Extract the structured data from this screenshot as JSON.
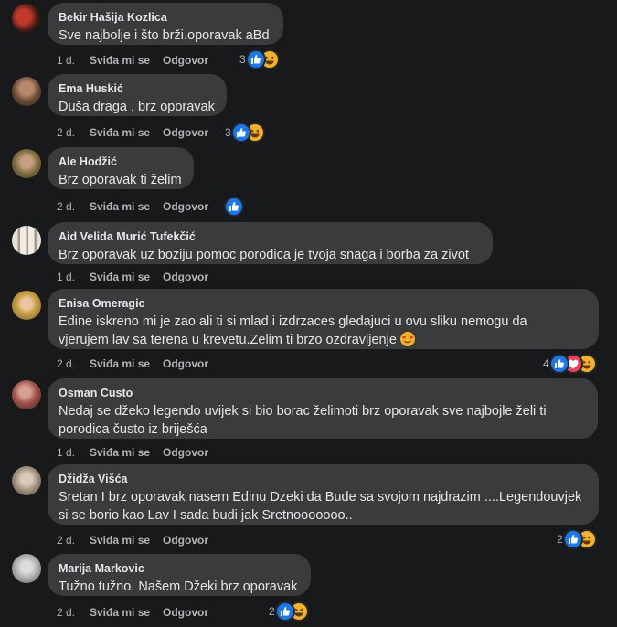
{
  "comments": [
    {
      "author": "Bekir Hašija Kozlica",
      "text": "Sve najbolje i što brži.oporavak aBd",
      "time": "1 d.",
      "like": "Sviđa mi se",
      "reply": "Odgovor",
      "count": "3"
    },
    {
      "author": "Ema Huskić",
      "text": "Duša draga , brz oporavak",
      "time": "2 d.",
      "like": "Sviđa mi se",
      "reply": "Odgovor",
      "count": "3"
    },
    {
      "author": "Ale Hodžić",
      "text": "Brz oporavak ti želim",
      "time": "2 d.",
      "like": "Sviđa mi se",
      "reply": "Odgovor",
      "count": ""
    },
    {
      "author": "Aid Velida Murić Tufekčić",
      "text": "Brz oporavak uz boziju pomoc porodica je tvoja snaga i borba za zivot",
      "time": "1 d.",
      "like": "Sviđa mi se",
      "reply": "Odgovor",
      "count": ""
    },
    {
      "author": "Enisa Omeragic",
      "text": "Edine iskreno mi je zao ali ti si mlad i izdrzaces gledajuci u ovu sliku nemogu da\nvjerujem lav sa terena u krevetu.Zelim ti brzo ozdravljenje",
      "time": "2 d.",
      "like": "Sviđa mi se",
      "reply": "Odgovor",
      "count": "4"
    },
    {
      "author": "Osman Custo",
      "text": "Nedaj se džeko legendo uvijek si bio borac želimoti brz oporavak sve najbojle želi ti\nporodica čusto iz briješća",
      "time": "1 d.",
      "like": "Sviđa mi se",
      "reply": "Odgovor",
      "count": ""
    },
    {
      "author": "Džidža Višća",
      "text": "Sretan I brz oporavak nasem Edinu Dzeki da Bude sa svojom najdrazim ....Legendouvjek\nsi se borio kao Lav I sada budi jak Sretnooooooo..",
      "time": "2 d.",
      "like": "Sviđa mi se",
      "reply": "Odgovor",
      "count": "2"
    },
    {
      "author": "Marija Markovic",
      "text": "Tužno tužno. Našem Džeki brz oporavak",
      "time": "2 d.",
      "like": "Sviđa mi se",
      "reply": "Odgovor",
      "count": "2"
    }
  ],
  "icons": {
    "like": "thumbs-up-icon",
    "haha": "haha-icon",
    "love": "heart-icon",
    "emoji": "heart-eyes-emoji"
  },
  "colors": {
    "background": "#18191a",
    "bubble": "#3a3b3c",
    "like_blue": "#1877f2",
    "haha_yellow": "#f7b125",
    "love_red": "#f33e58",
    "meta_text": "#b0b3b8"
  }
}
